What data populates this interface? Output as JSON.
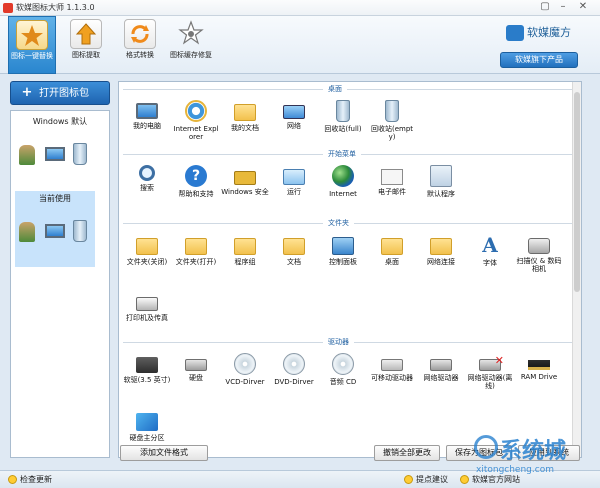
{
  "app": {
    "title": "软媒图标大师 1.1.3.0",
    "brand": "软媒魔方",
    "product_button": "软媒旗下产品"
  },
  "toolbar": {
    "items": [
      {
        "label": "图标一键替换",
        "icon": "star-icon",
        "active": true
      },
      {
        "label": "图标提取",
        "icon": "upload-arrow-icon",
        "active": false
      },
      {
        "label": "格式转换",
        "icon": "refresh-icon",
        "active": false
      },
      {
        "label": "图标缓存修复",
        "icon": "star-wrench-icon",
        "active": false
      }
    ]
  },
  "left": {
    "open_button": "打开图标包",
    "windows_default": "Windows 默认",
    "current": "当前使用"
  },
  "sections": [
    {
      "title": "桌面",
      "items": [
        {
          "label": "我的电脑",
          "icon": "i-pc"
        },
        {
          "label": "Internet Explorer",
          "icon": "i-ie"
        },
        {
          "label": "我的文档",
          "icon": "i-folder"
        },
        {
          "label": "网络",
          "icon": "i-net"
        },
        {
          "label": "回收站(full)",
          "icon": "i-bin"
        },
        {
          "label": "回收站(empty)",
          "icon": "i-bin"
        }
      ]
    },
    {
      "title": "开始菜单",
      "items": [
        {
          "label": "搜索",
          "icon": "i-search"
        },
        {
          "label": "帮助和支持",
          "icon": "i-help"
        },
        {
          "label": "Windows 安全",
          "icon": "i-lock"
        },
        {
          "label": "运行",
          "icon": "i-run"
        },
        {
          "label": "Internet",
          "icon": "i-globe"
        },
        {
          "label": "电子邮件",
          "icon": "i-mail"
        },
        {
          "label": "默认程序",
          "icon": "i-default"
        }
      ]
    },
    {
      "title": "文件夹",
      "items": [
        {
          "label": "文件夹(关闭)",
          "icon": "i-folder"
        },
        {
          "label": "文件夹(打开)",
          "icon": "i-folder"
        },
        {
          "label": "程序组",
          "icon": "i-folder"
        },
        {
          "label": "文档",
          "icon": "i-folder"
        },
        {
          "label": "控制面板",
          "icon": "i-panel"
        },
        {
          "label": "桌面",
          "icon": "i-folder"
        },
        {
          "label": "网络连接",
          "icon": "i-folder"
        },
        {
          "label": "字体",
          "icon": "i-font"
        },
        {
          "label": "扫描仪 & 数码相机",
          "icon": "i-camera"
        },
        {
          "label": "打印机及传真",
          "icon": "i-printer"
        }
      ]
    },
    {
      "title": "驱动器",
      "items": [
        {
          "label": "软驱(3.5 英寸)",
          "icon": "i-chip"
        },
        {
          "label": "硬盘",
          "icon": "i-disk"
        },
        {
          "label": "VCD-Dirver",
          "icon": "i-cd"
        },
        {
          "label": "DVD-Dirver",
          "icon": "i-cd"
        },
        {
          "label": "音频 CD",
          "icon": "i-cd"
        },
        {
          "label": "可移动驱动器",
          "icon": "i-usb"
        },
        {
          "label": "网络驱动器",
          "icon": "i-netdrive"
        },
        {
          "label": "网络驱动器(离线)",
          "icon": "i-netdrive-x"
        },
        {
          "label": "RAM Drive",
          "icon": "i-ram"
        },
        {
          "label": "硬盘主分区",
          "icon": "i-win"
        }
      ]
    }
  ],
  "bottom": {
    "add_format": "添加文件格式",
    "undo_all": "撤销全部更改",
    "save_as": "保存为图标包",
    "apply": "应用到系统"
  },
  "status": {
    "check_update": "检查更新",
    "suggest": "提点建议",
    "website": "软媒官方网站"
  },
  "watermark": {
    "main": "系统城",
    "sub": "xitongcheng.com"
  }
}
